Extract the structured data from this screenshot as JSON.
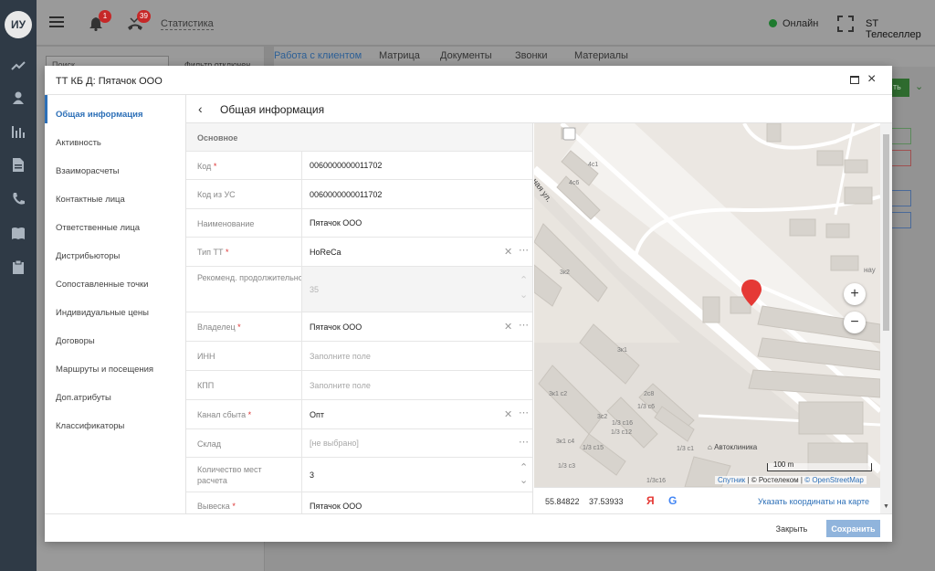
{
  "rail": {
    "avatar": "ИУ"
  },
  "topbar": {
    "notif_count": "1",
    "calls_count": "39",
    "statistics": "Статистика",
    "status": "Онлайн",
    "user": "ST Телеселлер"
  },
  "background": {
    "search_placeholder": "Поиск",
    "filter": "Фильтр отключен",
    "tabs": [
      "Работа с клиентом",
      "Матрица",
      "Документы",
      "Звонки",
      "Материалы"
    ],
    "green_button": "ть"
  },
  "modal": {
    "title": "ТТ КБ Д: Пятачок ООО",
    "content_title": "Общая информация",
    "sidebar": [
      "Общая информация",
      "Активность",
      "Взаиморасчеты",
      "Контактные лица",
      "Ответственные лица",
      "Дистрибьюторы",
      "Сопоставленные точки",
      "Индивидуальные цены",
      "Договоры",
      "Маршруты и посещения",
      "Доп.атрибуты",
      "Классификаторы"
    ],
    "section": "Основное",
    "fields": [
      {
        "label": "Код",
        "required": "*",
        "value": "0060000000011702"
      },
      {
        "label": "Код из УС",
        "required": "",
        "value": "0060000000011702"
      },
      {
        "label": "Наименование",
        "required": "",
        "value": "Пятачок ООО"
      },
      {
        "label": "Тип ТТ",
        "required": "*",
        "value": "HoReCa"
      },
      {
        "label": "Рекоменд. продолжительность посещения в минутах",
        "required": "",
        "value": "35"
      },
      {
        "label": "Владелец",
        "required": "*",
        "value": "Пятачок ООО"
      },
      {
        "label": "ИНН",
        "required": "",
        "value": "Заполните поле"
      },
      {
        "label": "КПП",
        "required": "",
        "value": "Заполните поле"
      },
      {
        "label": "Канал сбыта",
        "required": "*",
        "value": "Опт"
      },
      {
        "label": "Склад",
        "required": "",
        "value": "[не выбрано]"
      },
      {
        "label": "Количество мест расчета",
        "required": "",
        "value": "3"
      },
      {
        "label": "Вывеска",
        "required": "*",
        "value": "Пятачок ООО"
      }
    ],
    "map": {
      "street": "ная ул.",
      "labels": [
        "4с1",
        "4с6",
        "3к2",
        "3к1",
        "3к1 с2",
        "3с2",
        "1/3 с16",
        "1/3 с12",
        "1/3 с15",
        "1/3 с1",
        "1/3 с3",
        "3к1 с4",
        "2с8",
        "1/3с16",
        "1/3 с6",
        "нау"
      ],
      "poi": "Автоклиника",
      "scale": "100 m",
      "attribution_links": [
        "Спутник",
        "© Ростелеком",
        "© OpenStreetMap"
      ],
      "zoom_in": "+",
      "zoom_out": "−",
      "lat": "55.84822",
      "lon": "37.53933",
      "yandex": "Я",
      "google": "G",
      "set_coords": "Указать координаты на карте",
      "pin_color": "#e53935"
    },
    "close_button": "Закрыть",
    "save_button": "Сохранить"
  }
}
